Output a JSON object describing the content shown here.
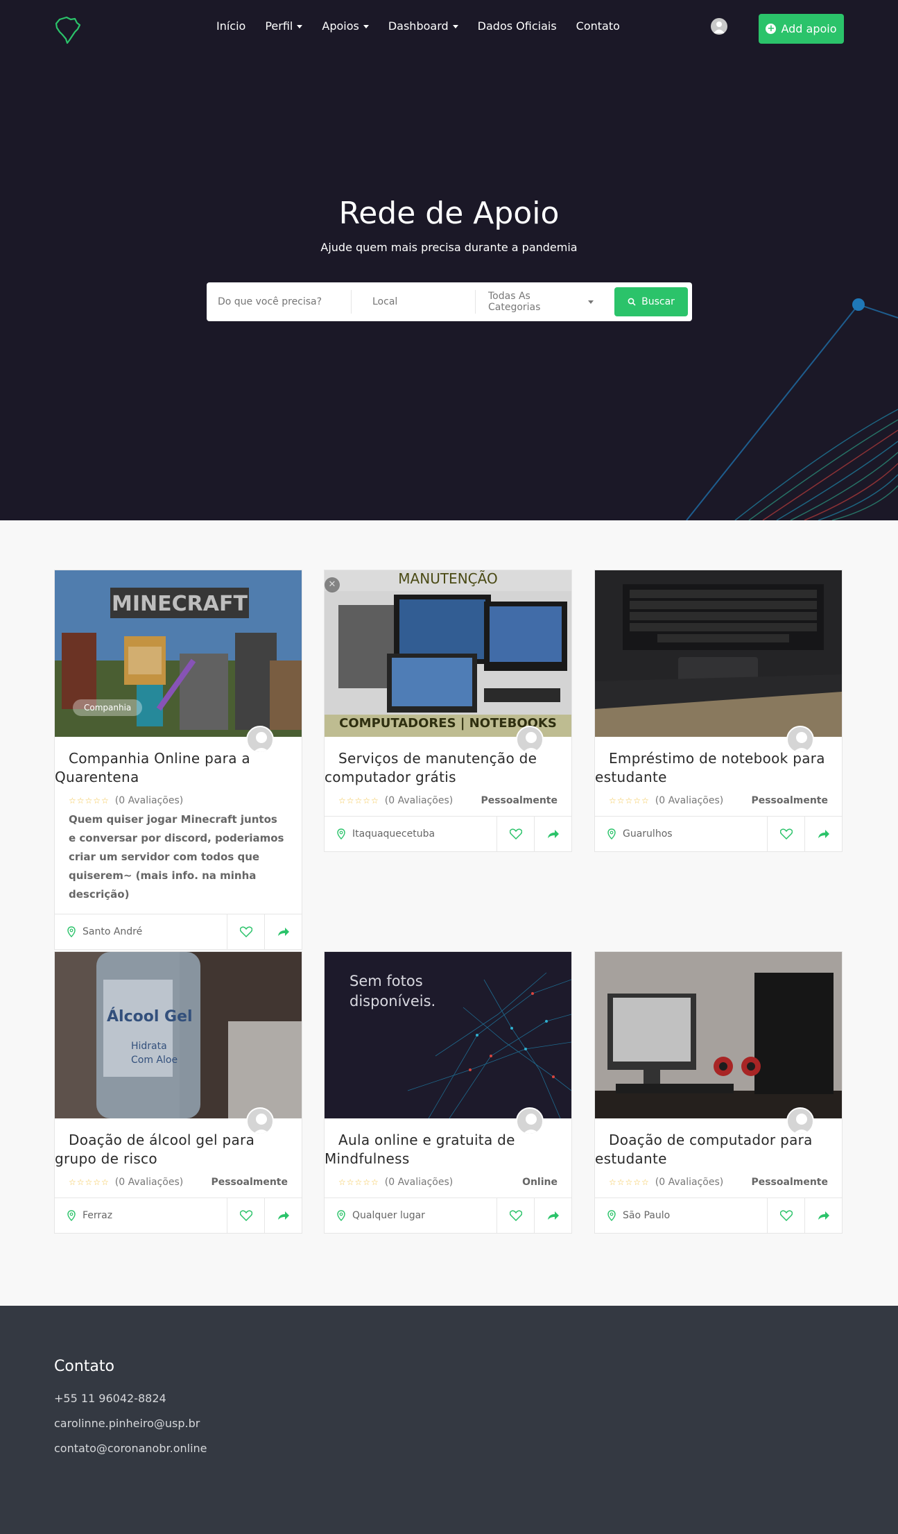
{
  "nav": {
    "items": [
      {
        "label": "Início",
        "dropdown": false
      },
      {
        "label": "Perfil",
        "dropdown": true
      },
      {
        "label": "Apoios",
        "dropdown": true
      },
      {
        "label": "Dashboard",
        "dropdown": true
      },
      {
        "label": "Dados Oficiais",
        "dropdown": false
      },
      {
        "label": "Contato",
        "dropdown": false
      }
    ],
    "add_button": "Add apoio",
    "icons": {
      "logo": "brazil-map-icon",
      "user": "user-icon",
      "add": "plus-circle-icon"
    }
  },
  "hero": {
    "title": "Rede de Apoio",
    "subtitle": "Ajude quem mais precisa durante a pandemia"
  },
  "search": {
    "what_placeholder": "Do que você precisa?",
    "where_placeholder": "Local",
    "category": "Todas As Categorias",
    "button": "Buscar"
  },
  "cards": [
    {
      "title": "Companhia Online para a Quarentena",
      "rating": "(0 Avaliações)",
      "mode": "",
      "tag": "Companhia",
      "description": "Quem quiser jogar Minecraft juntos e conversar por discord, poderiamos criar um servidor com todos que quiserem~ (mais info. na minha descrição)",
      "location": "Santo André",
      "image": "minecraft"
    },
    {
      "title": "Serviços de manutenção de computador grátis",
      "rating": "(0 Avaliações)",
      "mode": "Pessoalmente",
      "location": "Itaquaquecetuba",
      "image": "computadores",
      "image_text_top": "MANUTENÇÃO",
      "image_text_bottom": "COMPUTADORES | NOTEBOOKS"
    },
    {
      "title": "Empréstimo de notebook para estudante",
      "rating": "(0 Avaliações)",
      "mode": "Pessoalmente",
      "location": "Guarulhos",
      "image": "notebook"
    },
    {
      "title": "Doação de álcool gel para grupo de risco",
      "rating": "(0 Avaliações)",
      "mode": "Pessoalmente",
      "location": "Ferraz",
      "image": "alcool-gel"
    },
    {
      "title": "Aula online e gratuita de Mindfulness",
      "rating": "(0 Avaliações)",
      "mode": "Online",
      "location": "Qualquer lugar",
      "image": "sem-fotos",
      "image_text": "Sem fotos disponíveis."
    },
    {
      "title": "Doação de computador para estudante",
      "rating": "(0 Avaliações)",
      "mode": "Pessoalmente",
      "location": "São Paulo",
      "image": "desktop"
    }
  ],
  "card_icons": {
    "location": "map-pin-icon",
    "favorite": "heart-icon",
    "share": "share-arrow-icon",
    "avatar": "avatar-icon",
    "rating": "star-icon"
  },
  "stars": "☆☆☆☆☆",
  "footer": {
    "title": "Contato",
    "phone": "+55 11 96042-8824",
    "email1": "carolinne.pinheiro@usp.br",
    "email2": "contato@coronanobr.online"
  },
  "colors": {
    "accent": "#2bc36a",
    "hero_bg": "#1b1827",
    "footer_bg": "#343942"
  }
}
